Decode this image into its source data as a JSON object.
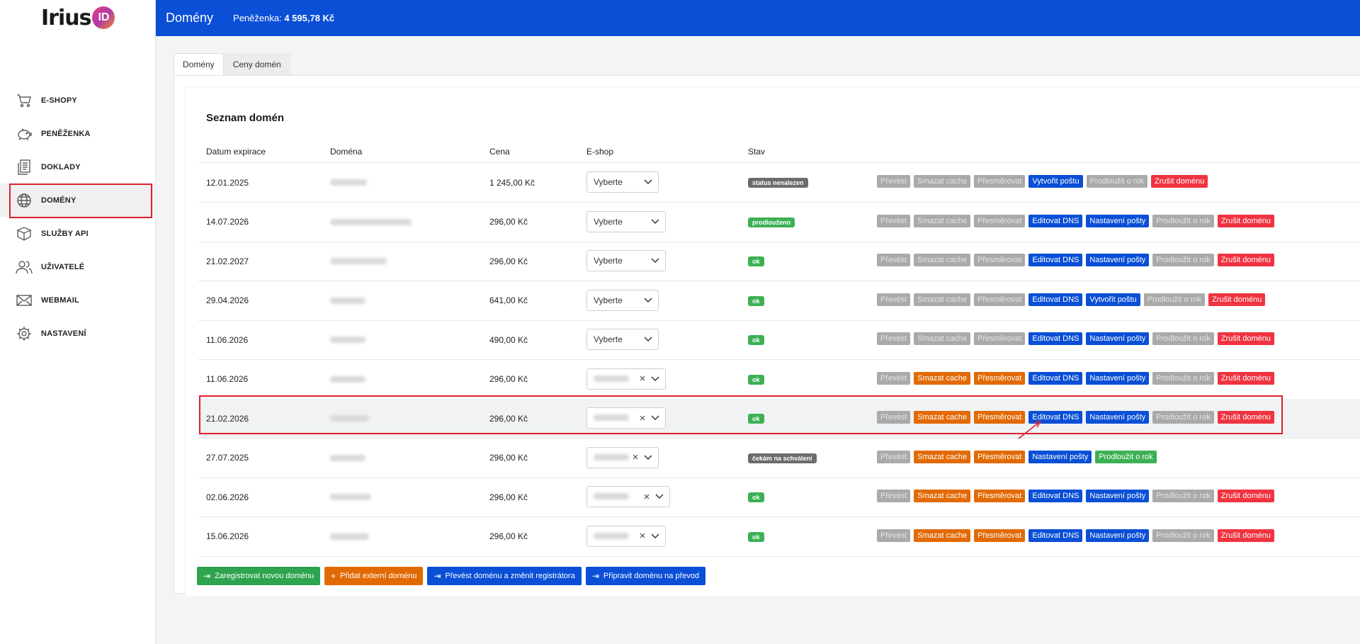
{
  "brand": {
    "logo_text": "Irius",
    "logo_badge": "ID"
  },
  "topbar": {
    "title": "Domény",
    "wallet_label": "Peněženka:",
    "wallet_value": "4 595,78 Kč"
  },
  "sidebar": {
    "items": [
      {
        "label": "E-SHOPY",
        "icon": "cart-icon"
      },
      {
        "label": "PENĚŽENKA",
        "icon": "piggy-bank-icon"
      },
      {
        "label": "DOKLADY",
        "icon": "documents-icon"
      },
      {
        "label": "DOMÉNY",
        "icon": "globe-icon",
        "active": true
      },
      {
        "label": "SLUŽBY API",
        "icon": "box-icon"
      },
      {
        "label": "UŽIVATELÉ",
        "icon": "users-icon"
      },
      {
        "label": "WEBMAIL",
        "icon": "envelope-icon"
      },
      {
        "label": "NASTAVENÍ",
        "icon": "gear-icon"
      }
    ]
  },
  "tabs": [
    {
      "label": "Domény",
      "active": true
    },
    {
      "label": "Ceny domén",
      "active": false
    }
  ],
  "table": {
    "title": "Seznam domén",
    "headers": {
      "expiry": "Datum expirace",
      "domain": "Doména",
      "price": "Cena",
      "eshop": "E-shop",
      "status": "Stav"
    },
    "select_placeholder": "Vyberte",
    "rows": [
      {
        "expiry": "12.01.2025",
        "price": "1 245,00 Kč",
        "eshop_selected": false,
        "status": "status nenalezen",
        "status_color": "#6c6c6c",
        "actions": [
          "Převést",
          "Smazat cache",
          "Přesměrovat",
          "Vytvořit poštu",
          "Prodloužit o rok",
          "Zrušit doménu"
        ],
        "action_styles": [
          "dis",
          "dis",
          "dis",
          "blu",
          "dis",
          "red"
        ]
      },
      {
        "expiry": "14.07.2026",
        "price": "296,00 Kč",
        "eshop_selected": false,
        "status": "prodlouženo",
        "status_color": "#3cb054",
        "actions": [
          "Převést",
          "Smazat cache",
          "Přesměrovat",
          "Editovat DNS",
          "Nastavení pošty",
          "Prodloužit o rok",
          "Zrušit doménu"
        ],
        "action_styles": [
          "dis",
          "dis",
          "dis",
          "blu",
          "blu",
          "dis",
          "red"
        ]
      },
      {
        "expiry": "21.02.2027",
        "price": "296,00 Kč",
        "eshop_selected": false,
        "status": "ok",
        "status_color": "#3cb054",
        "actions": [
          "Převést",
          "Smazat cache",
          "Přesměrovat",
          "Editovat DNS",
          "Nastavení pošty",
          "Prodloužit o rok",
          "Zrušit doménu"
        ],
        "action_styles": [
          "dis",
          "dis",
          "dis",
          "blu",
          "blu",
          "dis",
          "red"
        ]
      },
      {
        "expiry": "29.04.2026",
        "price": "641,00 Kč",
        "eshop_selected": false,
        "status": "ok",
        "status_color": "#3cb054",
        "actions": [
          "Převést",
          "Smazat cache",
          "Přesměrovat",
          "Editovat DNS",
          "Vytvořit poštu",
          "Prodloužit o rok",
          "Zrušit doménu"
        ],
        "action_styles": [
          "dis",
          "dis",
          "dis",
          "blu",
          "blu",
          "dis",
          "red"
        ]
      },
      {
        "expiry": "11.06.2026",
        "price": "490,00 Kč",
        "eshop_selected": false,
        "status": "ok",
        "status_color": "#3cb054",
        "actions": [
          "Převést",
          "Smazat cache",
          "Přesměrovat",
          "Editovat DNS",
          "Nastavení pošty",
          "Prodloužit o rok",
          "Zrušit doménu"
        ],
        "action_styles": [
          "dis",
          "dis",
          "dis",
          "blu",
          "blu",
          "dis",
          "red"
        ]
      },
      {
        "expiry": "11.06.2026",
        "price": "296,00 Kč",
        "eshop_selected": true,
        "status": "ok",
        "status_color": "#3cb054",
        "actions": [
          "Převést",
          "Smazat cache",
          "Přesměrovat",
          "Editovat DNS",
          "Nastavení pošty",
          "Prodloužit o rok",
          "Zrušit doménu"
        ],
        "action_styles": [
          "dis",
          "org",
          "org",
          "blu",
          "blu",
          "dis",
          "red"
        ]
      },
      {
        "expiry": "21.02.2026",
        "price": "296,00 Kč",
        "eshop_selected": true,
        "highlighted": true,
        "status": "ok",
        "status_color": "#3cb054",
        "actions": [
          "Převést",
          "Smazat cache",
          "Přesměrovat",
          "Editovat DNS",
          "Nastavení pošty",
          "Prodloužit o rok",
          "Zrušit doménu"
        ],
        "action_styles": [
          "dis",
          "org",
          "org",
          "blu",
          "blu",
          "dis",
          "red"
        ]
      },
      {
        "expiry": "27.07.2025",
        "price": "296,00 Kč",
        "eshop_selected": true,
        "status": "čekám na schválení",
        "status_color": "#6c6c6c",
        "actions": [
          "Převést",
          "Smazat cache",
          "Přesměrovat",
          "Nastavení pošty",
          "Prodloužit o rok"
        ],
        "action_styles": [
          "dis",
          "org",
          "org",
          "blu",
          "grn"
        ]
      },
      {
        "expiry": "02.06.2026",
        "price": "296,00 Kč",
        "eshop_selected": true,
        "status": "ok",
        "status_color": "#3cb054",
        "actions": [
          "Převést",
          "Smazat cache",
          "Přesměrovat",
          "Editovat DNS",
          "Nastavení pošty",
          "Prodloužit o rok",
          "Zrušit doménu"
        ],
        "action_styles": [
          "dis",
          "org",
          "org",
          "blu",
          "blu",
          "dis",
          "red"
        ]
      },
      {
        "expiry": "15.06.2026",
        "price": "296,00 Kč",
        "eshop_selected": true,
        "status": "ok",
        "status_color": "#3cb054",
        "actions": [
          "Převést",
          "Smazat cache",
          "Přesměrovat",
          "Editovat DNS",
          "Nastavení pošty",
          "Prodloužit o rok",
          "Zrušit doménu"
        ],
        "action_styles": [
          "dis",
          "org",
          "org",
          "blu",
          "blu",
          "dis",
          "red"
        ]
      }
    ]
  },
  "bottom_buttons": [
    {
      "label": "Zaregistrovat novou doménu",
      "color": "#2ea44f",
      "icon": "sign-in-icon"
    },
    {
      "label": "Přidat externí doménu",
      "color": "#e26a05",
      "icon": "plus-icon"
    },
    {
      "label": "Převést doménu a změnit registrátora",
      "color": "#0a4fd6",
      "icon": "sign-in-icon"
    },
    {
      "label": "Připravit doménu na převod",
      "color": "#0a4fd6",
      "icon": "sign-in-icon"
    }
  ]
}
